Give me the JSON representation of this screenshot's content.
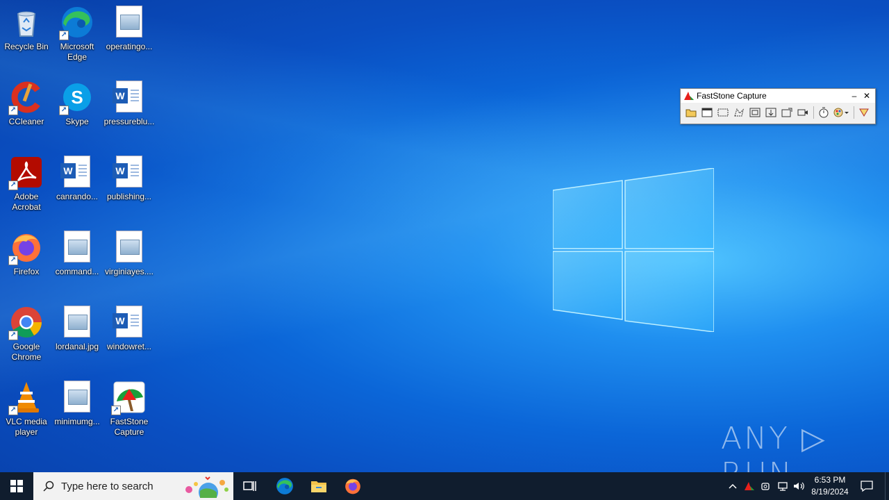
{
  "desktop": {
    "icons": [
      {
        "label": "Recycle Bin",
        "icon": "recycle-bin-icon"
      },
      {
        "label": "Microsoft Edge",
        "icon": "edge-icon"
      },
      {
        "label": "operatingo...",
        "icon": "image-file-icon"
      },
      {
        "label": "CCleaner",
        "icon": "ccleaner-icon"
      },
      {
        "label": "Skype",
        "icon": "skype-icon"
      },
      {
        "label": "pressureblu...",
        "icon": "word-doc-icon"
      },
      {
        "label": "Adobe Acrobat",
        "icon": "acrobat-icon"
      },
      {
        "label": "canrando...",
        "icon": "word-doc-icon"
      },
      {
        "label": "publishing...",
        "icon": "word-doc-icon"
      },
      {
        "label": "Firefox",
        "icon": "firefox-icon"
      },
      {
        "label": "command...",
        "icon": "image-file-icon"
      },
      {
        "label": "virginiayes....",
        "icon": "image-file-icon"
      },
      {
        "label": "Google Chrome",
        "icon": "chrome-icon"
      },
      {
        "label": "lordanal.jpg",
        "icon": "image-file-icon"
      },
      {
        "label": "windowret...",
        "icon": "word-doc-icon"
      },
      {
        "label": "VLC media player",
        "icon": "vlc-icon"
      },
      {
        "label": "minimumg...",
        "icon": "image-file-icon"
      },
      {
        "label": "FastStone Capture",
        "icon": "faststone-icon"
      }
    ]
  },
  "faststone": {
    "title": "FastStone Capture",
    "minimize": "–",
    "close": "✕"
  },
  "watermark": "ANY ▷ RUN",
  "taskbar": {
    "search_placeholder": "Type here to search",
    "time": "6:53 PM",
    "date": "8/19/2024"
  },
  "colors": {
    "taskbar_bg": "#101d2e",
    "accent": "#0a6ad8"
  }
}
